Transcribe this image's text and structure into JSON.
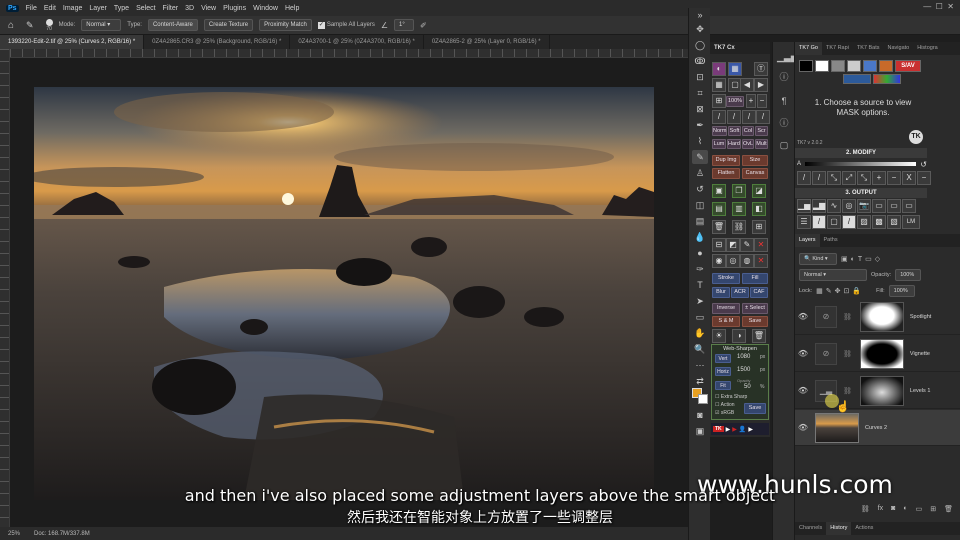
{
  "menubar": {
    "logo": "Ps",
    "items": [
      "File",
      "Edit",
      "Image",
      "Layer",
      "Type",
      "Select",
      "Filter",
      "3D",
      "View",
      "Plugins",
      "Window",
      "Help"
    ]
  },
  "options": {
    "brush_size": "70",
    "mode_label": "Mode:",
    "mode_value": "Normal",
    "type_label": "Type:",
    "type_options": [
      "Content-Aware",
      "Create Texture",
      "Proximity Match"
    ],
    "sample_all_layers": "Sample All Layers",
    "angle": "1°"
  },
  "tabs": [
    {
      "label": "1393220-Edit-2.tif @ 25% (Curves 2, RGB/16) *",
      "active": true
    },
    {
      "label": "0Z4A2865.CR3 @ 25% (Background, RGB/16) *",
      "active": false
    },
    {
      "label": "0Z4A3700-1 @ 25% (0Z4A3700, RGB/16) *",
      "active": false
    },
    {
      "label": "0Z4A2865-2 @ 25% (Layer 0, RGB/16) *",
      "active": false
    }
  ],
  "status": {
    "zoom": "25%",
    "doc": "Doc: 168.7M/337.8M"
  },
  "tk7cx": {
    "title": "TK7 Cx",
    "buttons": {
      "norm": "Norm",
      "soft": "Soft",
      "col": "Col",
      "scr": "Scr",
      "lum": "Lum",
      "hard": "Hard",
      "ovl": "OvL",
      "mult": "Mult",
      "dup_img": "Dup Img",
      "size": "Size",
      "flatten": "Flatten",
      "canvas": "Canvas",
      "stroke": "Stroke",
      "fill": "Fill",
      "blur": "Blur",
      "acr": "ACR",
      "caf": "CAF",
      "inverse": "Inverse",
      "select": "± Select",
      "s_m": "S & M",
      "save": "Save",
      "zoom100": "100%"
    },
    "web_sharpen": {
      "title": "Web-Sharpen",
      "vert_label": "Vert",
      "vert_value": "1080",
      "vert_unit": "px",
      "horiz_label": "Horiz",
      "horiz_value": "1500",
      "horiz_unit": "px",
      "fit_label": "Fit",
      "opacity_label": "Opacity",
      "opacity_value": "50",
      "opacity_unit": "%",
      "extra_sharp": "Extra Sharp",
      "action": "Action",
      "srgb": "sRGB",
      "save": "Save"
    },
    "tk_label": "TK"
  },
  "tk7go": {
    "tabs": [
      "TK7 Go",
      "TK7 Rapi",
      "TK7 Bats",
      "Navigato",
      "Histogra"
    ],
    "sav_label": "S/AV",
    "instruction": "1. Choose a source to view MASK options.",
    "version": "TK7 v 2.0.2",
    "modify_title": "2. MODIFY",
    "output_title": "3. OUTPUT",
    "lm_label": "LM",
    "a_label": "A",
    "x_label": "X",
    "ops": [
      "+",
      "−",
      "X",
      "−"
    ]
  },
  "layers_panel": {
    "tabs": [
      "Layers",
      "Paths"
    ],
    "kind_label": "Kind",
    "blend_mode": "Normal",
    "opacity_label": "Opacity:",
    "opacity_value": "100%",
    "lock_label": "Lock:",
    "fill_label": "Fill:",
    "fill_value": "100%",
    "layers": [
      {
        "name": "Spotlight",
        "selected": false
      },
      {
        "name": "Vignette",
        "selected": false
      },
      {
        "name": "Levels 1",
        "selected": false
      },
      {
        "name": "Curves 2",
        "selected": true
      }
    ],
    "bottom_tabs": [
      "Channels",
      "History",
      "Actions"
    ],
    "fx_label": "fx"
  },
  "subtitles": {
    "en": "and then i've also placed some adjustment layers above the smart object",
    "zh": "然后我还在智能对象上方放置了一些调整层"
  },
  "watermark": "www.hunls.com"
}
